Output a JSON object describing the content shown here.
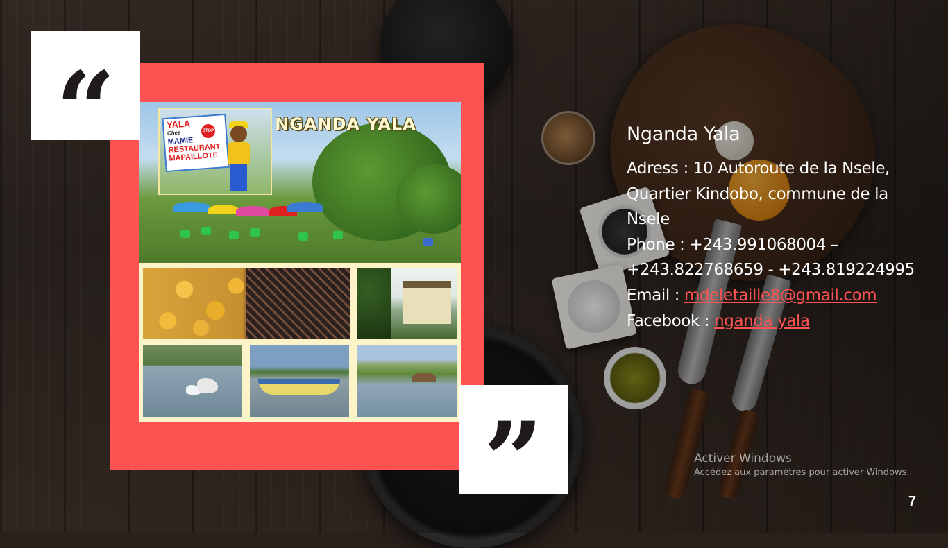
{
  "slide": {
    "number": "7"
  },
  "quotes": {
    "open": "“",
    "close": "”"
  },
  "photo": {
    "title": "NGANDA YALA",
    "sign": {
      "line1": "YALA",
      "line2": "Chez",
      "line3": "MAMIE",
      "line4": "RESTAURANT",
      "line5": "MAPAILLOTE",
      "stop": "STOP"
    }
  },
  "info": {
    "title": "Nganda Yala",
    "address_label": "Adress :",
    "address_value": "10 Autoroute de la Nsele, Quartier Kindobo, commune de la Nsele",
    "phone_label": "Phone :",
    "phone_value": "+243.991068004 – +243.822768659 - +243.819224995",
    "email_label": "Email :",
    "email_value": "mdeletaille8@gmail.com",
    "facebook_label": "Facebook :",
    "facebook_value": "nganda yala"
  },
  "watermark": {
    "line1": "Activer Windows",
    "line2": "Accédez aux paramètres pour activer Windows."
  },
  "colors": {
    "accent": "#fd5252",
    "text": "#ffffff",
    "quote_box": "#ffffff"
  }
}
